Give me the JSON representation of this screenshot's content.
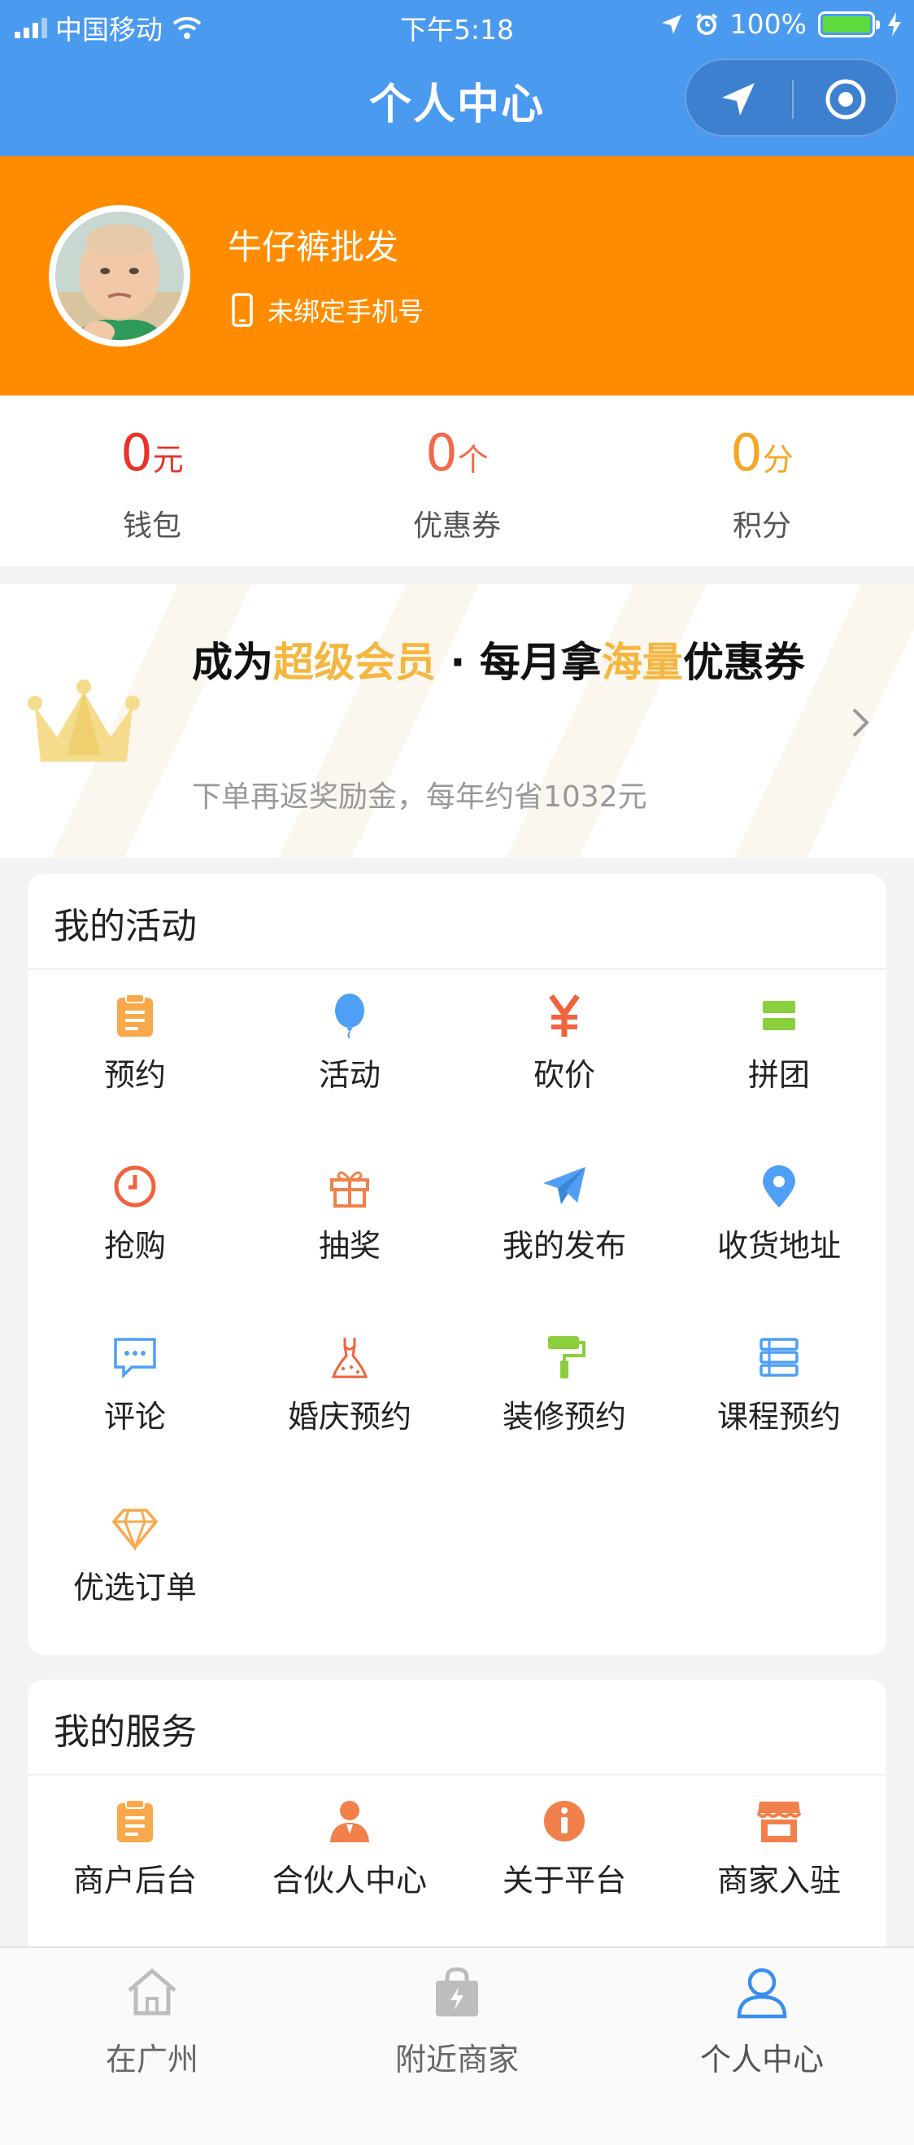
{
  "status_bar": {
    "carrier": "中国移动",
    "time": "下午5:18",
    "battery": "100%"
  },
  "header": {
    "title": "个人中心"
  },
  "profile": {
    "username": "牛仔裤批发",
    "phone_status": "未绑定手机号"
  },
  "stats": [
    {
      "value": "0",
      "unit": "元",
      "label": "钱包",
      "color": "#e8332b"
    },
    {
      "value": "0",
      "unit": "个",
      "label": "优惠券",
      "color": "#f26a4b"
    },
    {
      "value": "0",
      "unit": "分",
      "label": "积分",
      "color": "#f5a623"
    }
  ],
  "vip_banner": {
    "title_part1": "成为",
    "title_highlight1": "超级会员",
    "title_part2": " · 每月拿",
    "title_highlight2": "海量",
    "title_part3": "优惠券",
    "subtitle": "下单再返奖励金，每年约省1032元"
  },
  "activities": {
    "title": "我的活动",
    "items": [
      {
        "label": "预约",
        "icon": "clipboard-icon"
      },
      {
        "label": "活动",
        "icon": "balloon-icon"
      },
      {
        "label": "砍价",
        "icon": "yen-icon"
      },
      {
        "label": "拼团",
        "icon": "group-blocks-icon"
      },
      {
        "label": "抢购",
        "icon": "clock-icon"
      },
      {
        "label": "抽奖",
        "icon": "gift-icon"
      },
      {
        "label": "我的发布",
        "icon": "paper-plane-icon"
      },
      {
        "label": "收货地址",
        "icon": "location-pin-icon"
      },
      {
        "label": "评论",
        "icon": "comment-icon"
      },
      {
        "label": "婚庆预约",
        "icon": "wedding-dress-icon"
      },
      {
        "label": "装修预约",
        "icon": "paint-roller-icon"
      },
      {
        "label": "课程预约",
        "icon": "books-icon"
      },
      {
        "label": "优选订单",
        "icon": "diamond-icon"
      }
    ]
  },
  "services": {
    "title": "我的服务",
    "items": [
      {
        "label": "商户后台",
        "icon": "clipboard-icon"
      },
      {
        "label": "合伙人中心",
        "icon": "partner-icon"
      },
      {
        "label": "关于平台",
        "icon": "info-icon"
      },
      {
        "label": "商家入驻",
        "icon": "shop-icon"
      }
    ]
  },
  "tabbar": [
    {
      "label": "在广州",
      "icon": "home-icon"
    },
    {
      "label": "附近商家",
      "icon": "shopping-bag-icon"
    },
    {
      "label": "个人中心",
      "icon": "user-icon"
    }
  ]
}
